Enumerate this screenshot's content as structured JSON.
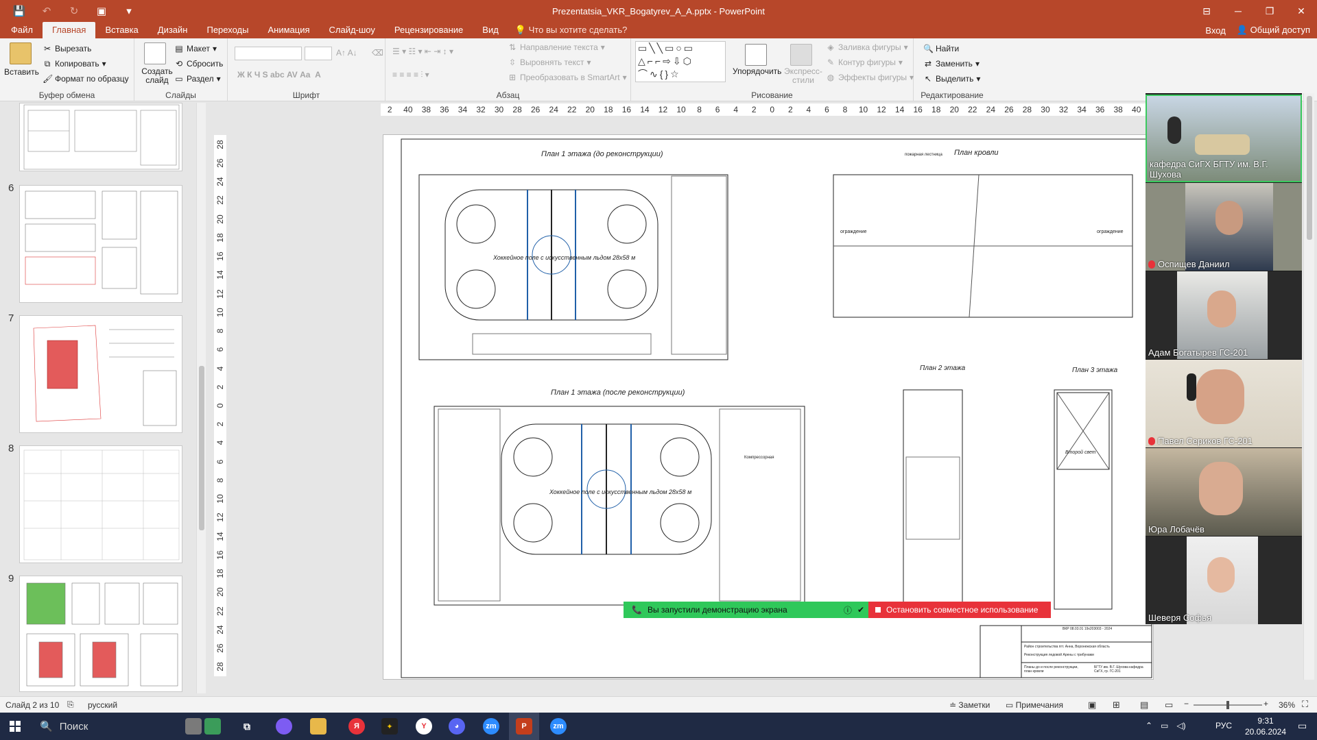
{
  "window": {
    "title": "Prezentatsia_VKR_Bogatyrev_A_A.pptx - PowerPoint",
    "minimize": "─",
    "restore": "❐",
    "close": "✕"
  },
  "tabs": {
    "items": [
      "Файл",
      "Главная",
      "Вставка",
      "Дизайн",
      "Переходы",
      "Анимация",
      "Слайд-шоу",
      "Рецензирование",
      "Вид"
    ],
    "tell_me": "Что вы хотите сделать?",
    "signin": "Вход",
    "share": "Общий доступ"
  },
  "ribbon": {
    "clipboard": {
      "label": "Буфер обмена",
      "paste": "Вставить",
      "cut": "Вырезать",
      "copy": "Копировать",
      "format_painter": "Формат по образцу"
    },
    "slides": {
      "label": "Слайды",
      "new_slide": "Создать слайд",
      "layout": "Макет",
      "reset": "Сбросить",
      "section": "Раздел"
    },
    "font": {
      "label": "Шрифт"
    },
    "paragraph": {
      "label": "Абзац",
      "text_direction": "Направление текста",
      "align_text": "Выровнять текст",
      "smartart": "Преобразовать в SmartArt"
    },
    "drawing": {
      "label": "Рисование",
      "arrange": "Упорядочить",
      "quick_styles": "Экспресс-стили",
      "shape_fill": "Заливка фигуры",
      "shape_outline": "Контур фигуры",
      "shape_effects": "Эффекты фигуры"
    },
    "editing": {
      "label": "Редактирование",
      "find": "Найти",
      "replace": "Заменить",
      "select": "Выделить"
    }
  },
  "thumbnails": [
    {
      "num": "6"
    },
    {
      "num": "7"
    },
    {
      "num": "8"
    },
    {
      "num": "9"
    }
  ],
  "ruler": {
    "h_ticks": [
      "2",
      "40",
      "38",
      "36",
      "34",
      "32",
      "30",
      "28",
      "26",
      "24",
      "22",
      "20",
      "18",
      "16",
      "14",
      "12",
      "10",
      "8",
      "6",
      "4",
      "2",
      "0",
      "2",
      "4",
      "6",
      "8",
      "10",
      "12",
      "14",
      "16",
      "18",
      "20",
      "22",
      "24",
      "26",
      "28",
      "30",
      "32",
      "34",
      "36",
      "38",
      "40"
    ],
    "v_ticks": [
      "28",
      "26",
      "24",
      "22",
      "20",
      "18",
      "16",
      "14",
      "12",
      "10",
      "8",
      "6",
      "4",
      "2",
      "0",
      "2",
      "4",
      "6",
      "8",
      "10",
      "12",
      "14",
      "16",
      "18",
      "20",
      "22",
      "24",
      "26",
      "28"
    ]
  },
  "slide": {
    "plan1_before": "План 1 этажа (до реконструкции)",
    "plan1_after": "План 1 этажа (после реконструкции)",
    "roof_plan": "План кровли",
    "plan2": "План 2 этажа",
    "plan3": "План 3 этажа",
    "rink_label": "Хоккейное поле с искусственным льдом 28x58 м",
    "second_light": "Второй свет",
    "fence": "ограждение",
    "fire_stairs": "пожарная лестница",
    "compressor": "Компрессорная",
    "stamp_code": "ВКР 08.03.01 19х203003 - 2024",
    "stamp_title": "Реконструкция ледовой Арены с трибунами",
    "stamp_place": "Район строительства пгт. Анна, Воронежская область",
    "stamp_sheet": "Планы до и после реконструкции, план кровли",
    "stamp_org": "БГТУ им. В.Г. Шухова кафедра СиГХ, гр. ГС-201"
  },
  "share_bar": {
    "started": "Вы запустили демонстрацию экрана",
    "stop": "Остановить совместное использование"
  },
  "participants": [
    {
      "name": "кафедра СиГХ БГТУ им. В.Г. Шухова",
      "muted": false
    },
    {
      "name": "Оспищев Даниил",
      "muted": true
    },
    {
      "name": "Адам Богатырев ГС-201",
      "muted": false
    },
    {
      "name": "Павел Сериков ГС-201",
      "muted": true
    },
    {
      "name": "Юра Лобачёв",
      "muted": false
    },
    {
      "name": "Шеверя Софья",
      "muted": false
    }
  ],
  "status": {
    "slide": "Слайд 2 из 10",
    "language": "русский",
    "notes": "Заметки",
    "comments": "Примечания",
    "zoom": "36%"
  },
  "taskbar": {
    "search": "Поиск",
    "lang": "РУС",
    "time": "9:31",
    "date": "20.06.2024"
  },
  "colors": {
    "accent": "#b7472a",
    "share_green": "#2fc85a",
    "share_red": "#e8323a",
    "taskbar": "#1f2a44"
  }
}
